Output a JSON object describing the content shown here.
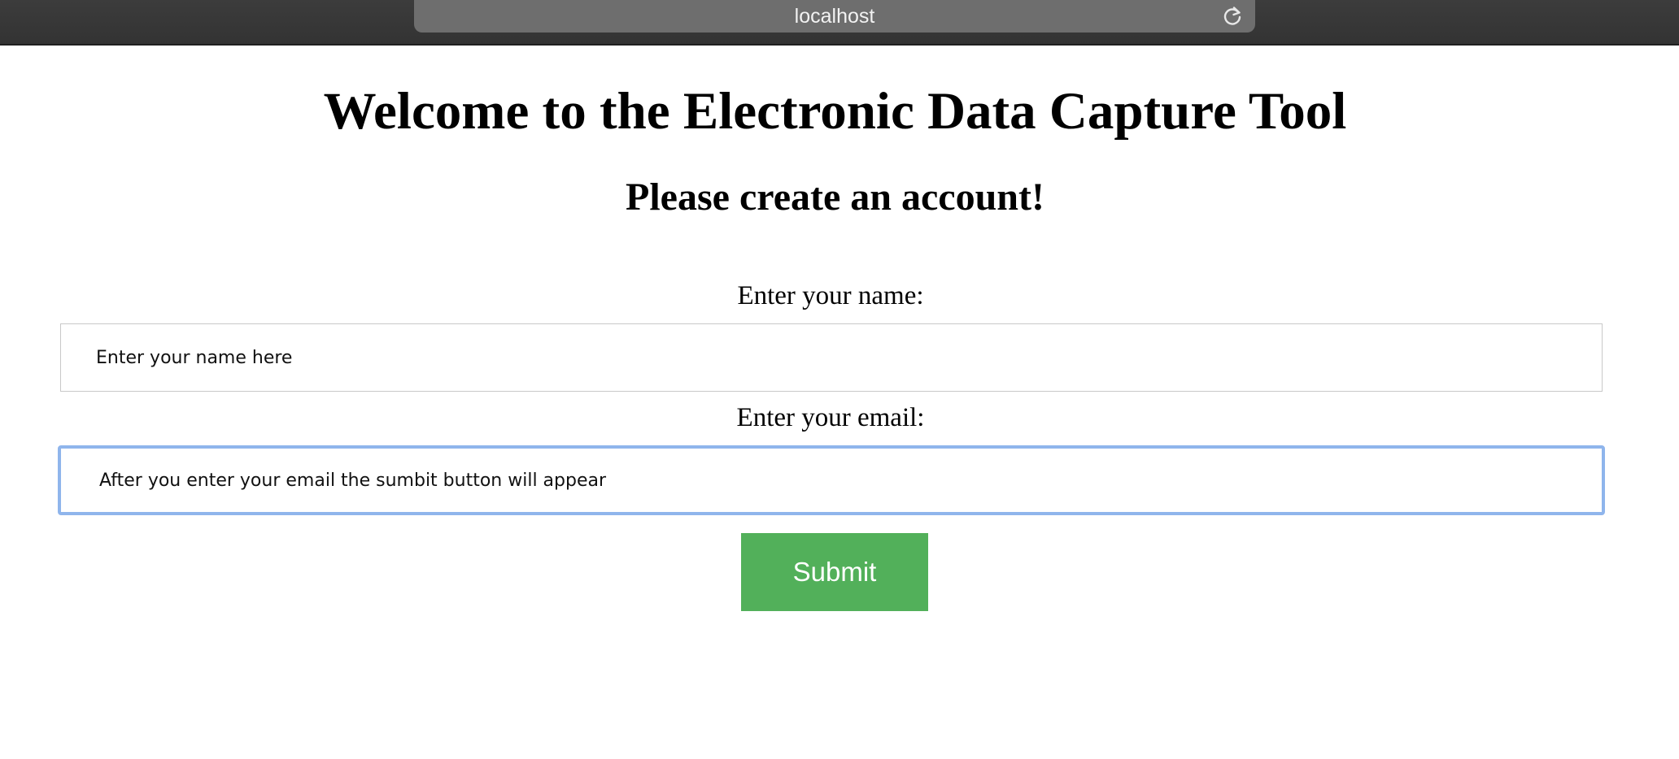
{
  "browser": {
    "url": "localhost",
    "reload_icon": "reload-icon"
  },
  "page": {
    "title": "Welcome to the Electronic Data Capture Tool",
    "subtitle": "Please create an account!",
    "name_label": "Enter your name:",
    "name_placeholder": "Enter your name here",
    "name_value": "",
    "email_label": "Enter your email:",
    "email_placeholder": "After you enter your email the sumbit button will appear",
    "email_value": "",
    "submit_label": "Submit"
  },
  "colors": {
    "toolbar_bg": "#3c3c3c",
    "url_bar_bg": "#6e6e6e",
    "focus_ring": "#8fb5ec",
    "submit_bg": "#52b05a"
  }
}
